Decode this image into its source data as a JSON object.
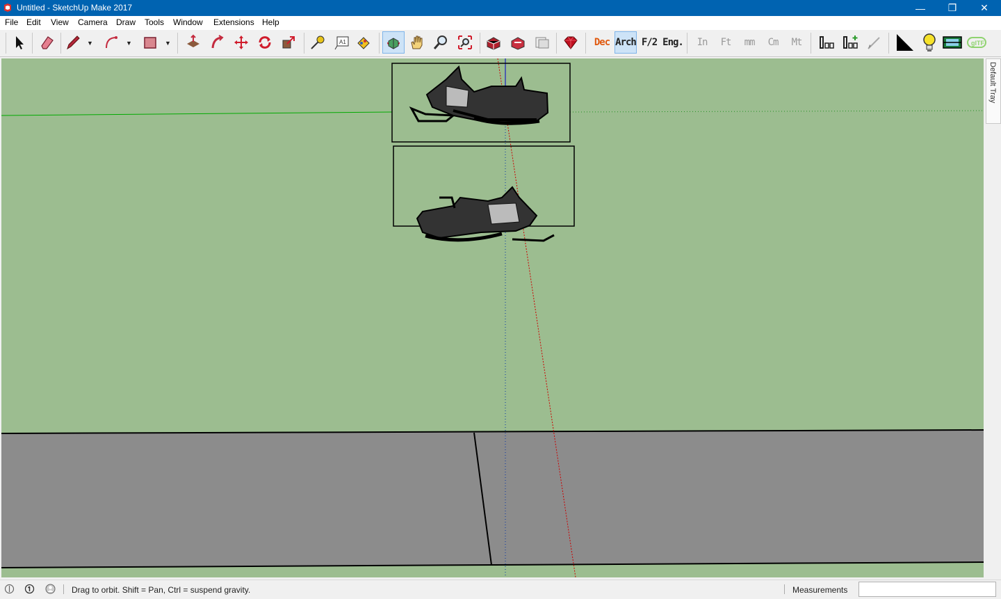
{
  "window": {
    "title": "Untitled - SketchUp Make 2017",
    "controls": {
      "minimize": "—",
      "restore": "❐",
      "close": "✕"
    }
  },
  "menu": [
    "File",
    "Edit",
    "View",
    "Camera",
    "Draw",
    "Tools",
    "Window",
    "Extensions",
    "Help"
  ],
  "toolbar": {
    "units": [
      "Dec",
      "Arch",
      "F/2",
      "Eng.",
      "In",
      "Ft",
      "mm",
      "Cm",
      "Mt"
    ],
    "active_tool": "orbit",
    "active_unit": "Arch",
    "icons": [
      "select-icon",
      "eraser-icon",
      "pencil-icon",
      "arc-icon",
      "shape-icon",
      "push-pull-icon",
      "follow-me-icon",
      "move-icon",
      "rotate-icon",
      "scale-icon",
      "tape-measure-icon",
      "text-icon",
      "paint-bucket-icon",
      "orbit-icon",
      "pan-icon",
      "zoom-icon",
      "zoom-extents-icon",
      "warehouse-icon",
      "extension-warehouse-icon",
      "layout-icon",
      "ruby-icon",
      "dimension-icon",
      "add-dimension-icon",
      "pen-icon",
      "triangle-icon",
      "lightbulb-icon",
      "section-icon",
      "gltf-icon"
    ]
  },
  "viewport": {
    "sky_color": "#9cbd90",
    "ground_color": "#8c8c8c",
    "axis_colors": {
      "red": "#d00000",
      "green": "#00aa00",
      "blue": "#0000cc"
    }
  },
  "tray": {
    "label": "Default Tray"
  },
  "status": {
    "text": "Drag to orbit. Shift = Pan, Ctrl = suspend gravity.",
    "measurements_label": "Measurements",
    "measurements_value": ""
  }
}
